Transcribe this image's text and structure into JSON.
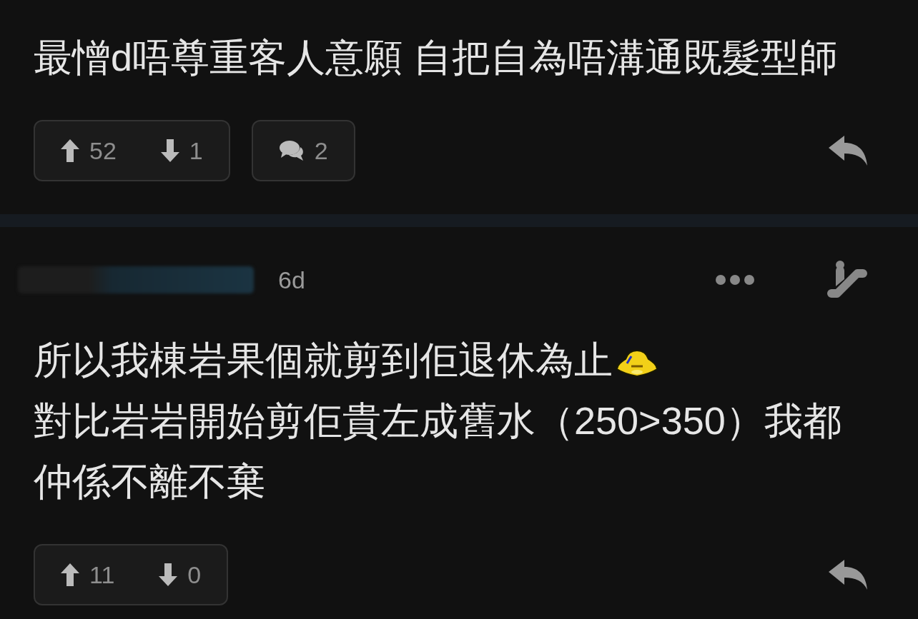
{
  "posts": [
    {
      "text_lines": [
        "最憎d唔尊重客人意願 自把自為唔溝通既髮型師"
      ],
      "emoticon": false,
      "upvotes": "52",
      "downvotes": "1",
      "comments": "2"
    },
    {
      "time": "6d",
      "text_lines": [
        "所以我棟岩果個就剪到佢退休為止",
        "對比岩岩開始剪佢貴左成舊水（250>350）我都",
        "仲係不離不棄"
      ],
      "emoticon": true,
      "upvotes": "11",
      "downvotes": "0"
    }
  ]
}
